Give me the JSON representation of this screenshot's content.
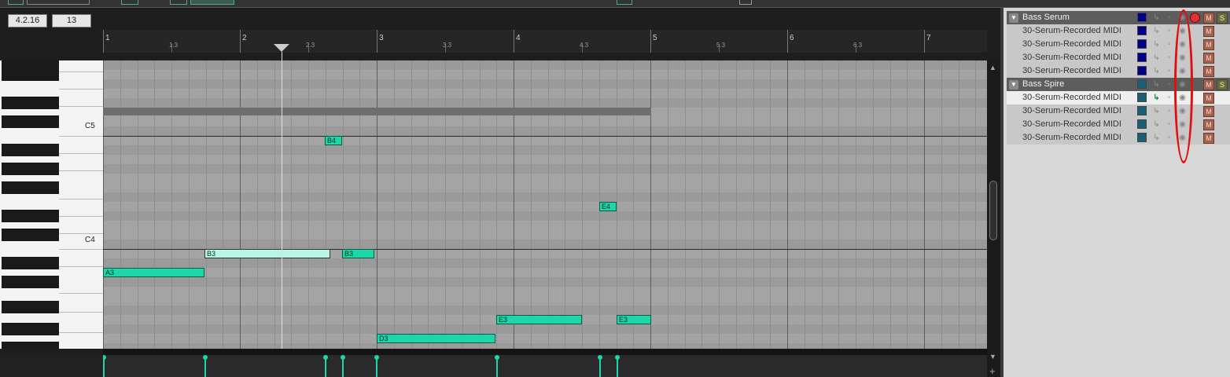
{
  "editor": {
    "position": "4.2.16",
    "grid_value": "13",
    "ruler": {
      "major": [
        "1",
        "2",
        "3",
        "4",
        "5",
        "6",
        "7"
      ],
      "minor": [
        "1.3",
        "2.3",
        "3.3",
        "4.3",
        "5.3",
        "6.3"
      ]
    },
    "key_labels": [
      "C5",
      "C4"
    ],
    "notes": [
      {
        "pitch": "B4",
        "selected": false
      },
      {
        "pitch": "E4",
        "selected": false
      },
      {
        "pitch": "B3",
        "selected": true
      },
      {
        "pitch": "B3",
        "selected": false
      },
      {
        "pitch": "A3",
        "selected": false
      },
      {
        "pitch": "E3",
        "selected": false
      },
      {
        "pitch": "E3",
        "selected": false
      },
      {
        "pitch": "D3",
        "selected": false
      }
    ],
    "note_color": "#1fd6a8",
    "selected_note_color": "#b8f5e6"
  },
  "tracks": [
    {
      "name": "Bass Serum",
      "type": "folder",
      "color": "#00008b",
      "record_armed": true
    },
    {
      "name": "30-Serum-Recorded MIDI",
      "type": "item",
      "color": "#00008b"
    },
    {
      "name": "30-Serum-Recorded MIDI",
      "type": "item",
      "color": "#00008b"
    },
    {
      "name": "30-Serum-Recorded MIDI",
      "type": "item",
      "color": "#00008b"
    },
    {
      "name": "30-Serum-Recorded MIDI",
      "type": "item",
      "color": "#00008b"
    },
    {
      "name": "Bass Spire",
      "type": "folder",
      "color": "#1a5f7a",
      "record_armed": false
    },
    {
      "name": "30-Serum-Recorded MIDI",
      "type": "item",
      "color": "#1a5f7a",
      "active": true
    },
    {
      "name": "30-Serum-Recorded MIDI",
      "type": "item",
      "color": "#1a5f7a"
    },
    {
      "name": "30-Serum-Recorded MIDI",
      "type": "item",
      "color": "#1a5f7a"
    },
    {
      "name": "30-Serum-Recorded MIDI",
      "type": "item",
      "color": "#1a5f7a"
    }
  ],
  "buttons": {
    "mute": "M",
    "solo": "S"
  },
  "icons": [
    "fold-arrow-icon",
    "swatch-icon",
    "route-icon",
    "lock-icon",
    "eye-icon",
    "record-icon",
    "plus-icon"
  ],
  "annotation_color": "#e01010"
}
